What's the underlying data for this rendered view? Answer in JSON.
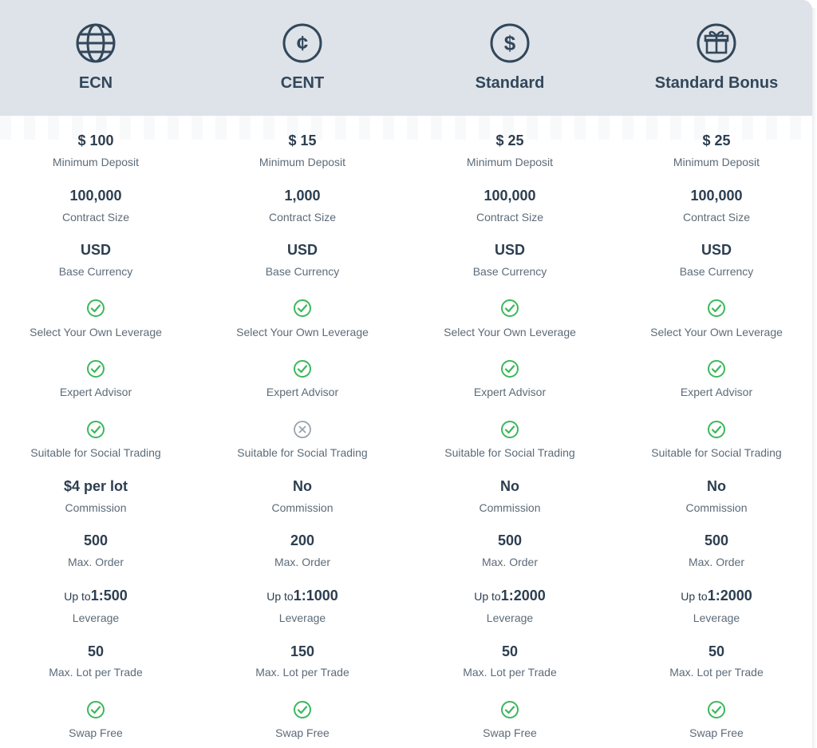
{
  "colors": {
    "header_bg": "#dde3e8",
    "check_green": "#3cb85c",
    "cross_gray": "#9aa3ab",
    "title_text": "#33475b",
    "label_text": "#5d6b78"
  },
  "columns": [
    {
      "title": "ECN",
      "icon": "globe-icon",
      "min_deposit": {
        "value": "$ 100",
        "label": "Minimum Deposit"
      },
      "contract_size": {
        "value": "100,000",
        "label": "Contract Size"
      },
      "base_currency": {
        "value": "USD",
        "label": "Base Currency"
      },
      "leverage_select": {
        "status": "check-icon",
        "label": "Select Your Own Leverage"
      },
      "expert_advisor": {
        "status": "check-icon",
        "label": "Expert Advisor"
      },
      "social_trading": {
        "status": "check-icon",
        "label": "Suitable for Social Trading"
      },
      "commission": {
        "value": "$4 per lot",
        "label": "Commission"
      },
      "max_order": {
        "value": "500",
        "label": "Max. Order"
      },
      "leverage": {
        "prefix": "Up to",
        "value": "1:500",
        "label": "Leverage"
      },
      "max_lot": {
        "value": "50",
        "label": "Max. Lot per Trade"
      },
      "swap_free": {
        "status": "check-icon",
        "label": "Swap Free"
      }
    },
    {
      "title": "CENT",
      "icon": "cent-coin-icon",
      "min_deposit": {
        "value": "$ 15",
        "label": "Minimum Deposit"
      },
      "contract_size": {
        "value": "1,000",
        "label": "Contract Size"
      },
      "base_currency": {
        "value": "USD",
        "label": "Base Currency"
      },
      "leverage_select": {
        "status": "check-icon",
        "label": "Select Your Own Leverage"
      },
      "expert_advisor": {
        "status": "check-icon",
        "label": "Expert Advisor"
      },
      "social_trading": {
        "status": "cross-icon",
        "label": "Suitable for Social Trading"
      },
      "commission": {
        "value": "No",
        "label": "Commission"
      },
      "max_order": {
        "value": "200",
        "label": "Max. Order"
      },
      "leverage": {
        "prefix": "Up to",
        "value": "1:1000",
        "label": "Leverage"
      },
      "max_lot": {
        "value": "150",
        "label": "Max. Lot per Trade"
      },
      "swap_free": {
        "status": "check-icon",
        "label": "Swap Free"
      }
    },
    {
      "title": "Standard",
      "icon": "dollar-coin-icon",
      "min_deposit": {
        "value": "$ 25",
        "label": "Minimum Deposit"
      },
      "contract_size": {
        "value": "100,000",
        "label": "Contract Size"
      },
      "base_currency": {
        "value": "USD",
        "label": "Base Currency"
      },
      "leverage_select": {
        "status": "check-icon",
        "label": "Select Your Own Leverage"
      },
      "expert_advisor": {
        "status": "check-icon",
        "label": "Expert Advisor"
      },
      "social_trading": {
        "status": "check-icon",
        "label": "Suitable for Social Trading"
      },
      "commission": {
        "value": "No",
        "label": "Commission"
      },
      "max_order": {
        "value": "500",
        "label": "Max. Order"
      },
      "leverage": {
        "prefix": "Up to",
        "value": "1:2000",
        "label": "Leverage"
      },
      "max_lot": {
        "value": "50",
        "label": "Max. Lot per Trade"
      },
      "swap_free": {
        "status": "check-icon",
        "label": "Swap Free"
      }
    },
    {
      "title": "Standard Bonus",
      "icon": "gift-icon",
      "min_deposit": {
        "value": "$ 25",
        "label": "Minimum Deposit"
      },
      "contract_size": {
        "value": "100,000",
        "label": "Contract Size"
      },
      "base_currency": {
        "value": "USD",
        "label": "Base Currency"
      },
      "leverage_select": {
        "status": "check-icon",
        "label": "Select Your Own Leverage"
      },
      "expert_advisor": {
        "status": "check-icon",
        "label": "Expert Advisor"
      },
      "social_trading": {
        "status": "check-icon",
        "label": "Suitable for Social Trading"
      },
      "commission": {
        "value": "No",
        "label": "Commission"
      },
      "max_order": {
        "value": "500",
        "label": "Max. Order"
      },
      "leverage": {
        "prefix": "Up to",
        "value": "1:2000",
        "label": "Leverage"
      },
      "max_lot": {
        "value": "50",
        "label": "Max. Lot per Trade"
      },
      "swap_free": {
        "status": "check-icon",
        "label": "Swap Free"
      }
    }
  ]
}
